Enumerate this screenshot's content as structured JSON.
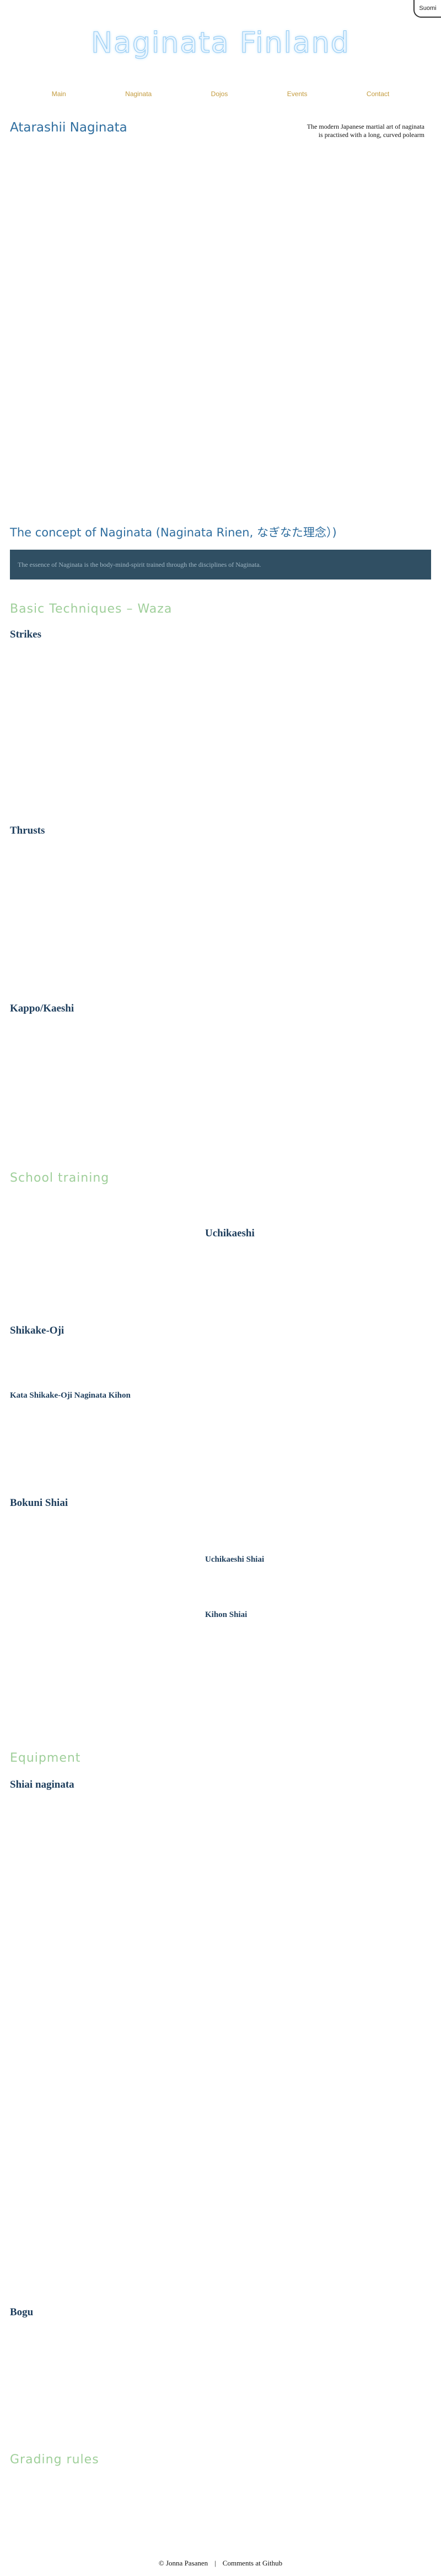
{
  "lang_tab": "Suomi",
  "site_title": "Naginata Finland",
  "nav": [
    "Main",
    "Naginata",
    "Dojos",
    "Events",
    "Contact"
  ],
  "intro": {
    "heading": "Atarashii Naginata",
    "quote_line1": "The modern Japanese martial art of naginata",
    "quote_line2": "is practised with a long, curved polearm"
  },
  "concept": {
    "heading": "The concept of Naginata (Naginata Rinen, なぎなた理念）)",
    "body": "The essence of Naginata is the body-mind-spirit trained through the disciplines of Naginata."
  },
  "techniques": {
    "heading": "Basic Techniques – Waza",
    "items": [
      "Strikes",
      "Thrusts",
      "Kappo/Kaeshi"
    ]
  },
  "training": {
    "heading": "School training",
    "center_label": "Uchikaeshi",
    "left_items": [
      "Shikake-Oji",
      "Kata Shikake-Oji Naginata Kihon"
    ],
    "kaikai": "Bokuni Shiai",
    "right_items": [
      "Uchikaeshi Shiai",
      "Kihon Shiai"
    ]
  },
  "equipment": {
    "heading": "Equipment",
    "item1": "Shiai naginata",
    "item2": "Bogu"
  },
  "grading": {
    "heading": "Grading rules"
  },
  "footer": {
    "author": "© Jonna Pasanen",
    "separator": "|",
    "link": "Comments at Github"
  }
}
